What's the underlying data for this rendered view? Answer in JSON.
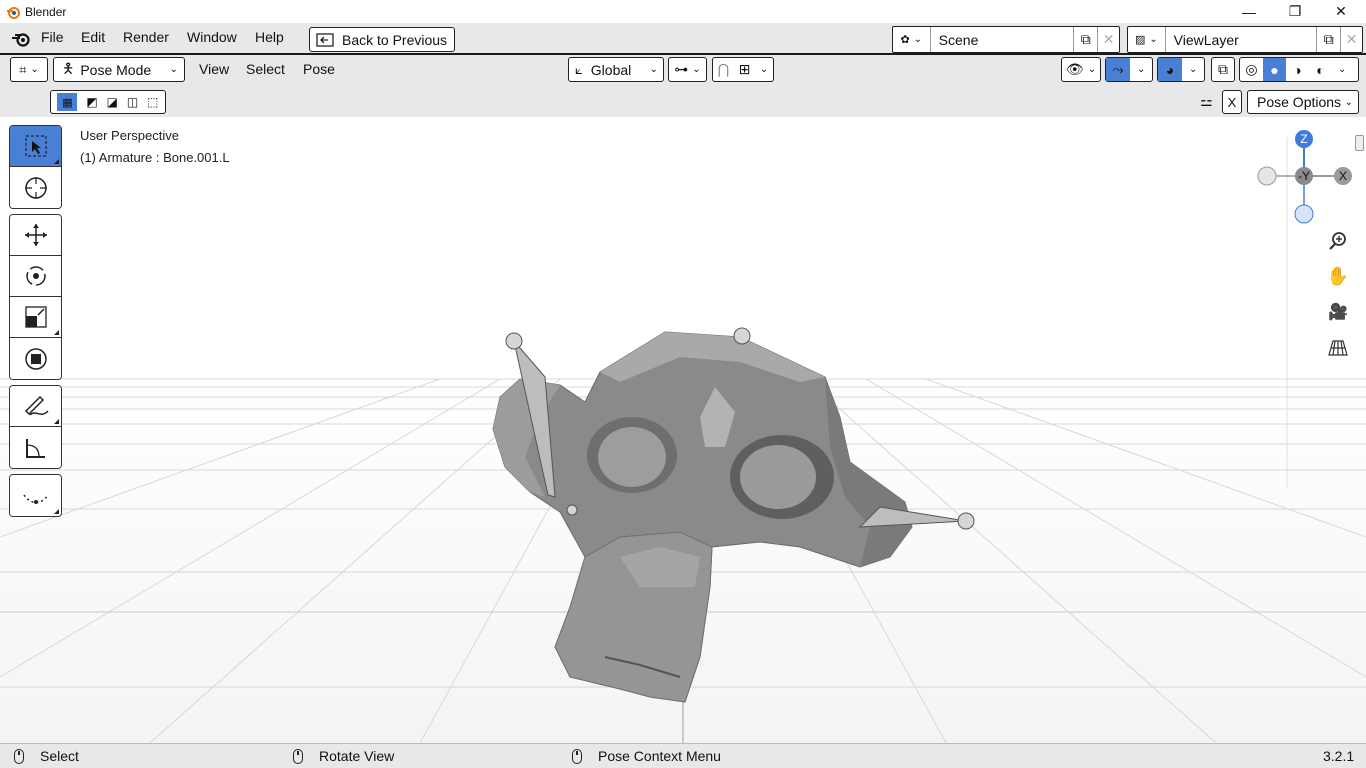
{
  "window": {
    "title": "Blender",
    "minimize": "—",
    "restore": "❐",
    "close": "✕"
  },
  "menubar": {
    "items": [
      "File",
      "Edit",
      "Render",
      "Window",
      "Help"
    ],
    "back_button": "Back to Previous",
    "scene_label": "Scene",
    "viewlayer_label": "ViewLayer"
  },
  "header": {
    "mode": "Pose Mode",
    "menus": [
      "View",
      "Select",
      "Pose"
    ],
    "orientation": "Global",
    "pose_options": "Pose Options",
    "x_label": "X"
  },
  "viewport": {
    "perspective": "User Perspective",
    "object_info": "(1) Armature : Bone.001.L",
    "gizmo": {
      "z": "Z",
      "y": "-Y",
      "x": "X"
    }
  },
  "statusbar": {
    "select": "Select",
    "rotate": "Rotate View",
    "context": "Pose Context Menu",
    "version": "3.2.1"
  },
  "colors": {
    "accent": "#4a7fd6",
    "header_bg": "#e8e8e8",
    "gizmo_z": "#3f7bd9",
    "gizmo_gray": "#9a9a9a"
  }
}
